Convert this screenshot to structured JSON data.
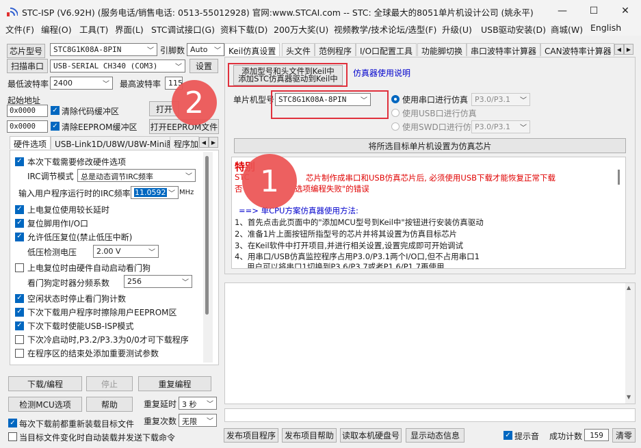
{
  "window": {
    "title": "STC-ISP (V6.92H) (服务电话/销售电话: 0513-55012928) 官网:www.STCAI.com  -- STC: 全球最大的8051单片机设计公司 (姚永平)",
    "minimize": "—",
    "maximize": "☐",
    "close": "✕"
  },
  "menu": [
    "文件(F)",
    "编程(O)",
    "工具(T)",
    "界面(L)",
    "STC调试接口(G)",
    "资料下载(D)",
    "200万大奖(U)",
    "视频教学/技术论坛/选型(F)",
    "升级(U)",
    "USB驱动安装(D)",
    "商城(W)",
    "English"
  ],
  "left": {
    "chip_label": "芯片型号",
    "chip_value": "STC8G1K08A-8PIN",
    "pin_label": "引脚数",
    "pin_value": "Auto",
    "scan_button": "扫描串口",
    "port_value": "USB-SERIAL CH340 (COM3)",
    "settings_button": "设置",
    "min_baud_label": "最低波特率",
    "min_baud_value": "2400",
    "max_baud_label": "最高波特率",
    "max_baud_value": "115",
    "start_addr_label": "起始地址",
    "addr1": "0x0000",
    "clear_code_label": "清除代码缓冲区",
    "open_prog_button": "打开",
    "addr2": "0x0000",
    "clear_eeprom_label": "清除EEPROM缓冲区",
    "open_eeprom_button": "打开EEPROM文件",
    "tabs": [
      "硬件选项",
      "USB-Link1D/U8W/U8W-Mini脱机",
      "程序加"
    ],
    "options": {
      "opt1": "本次下载需要修改硬件选项",
      "irc_mode_label": "IRC调节模式",
      "irc_mode_value": "总是动态调节IRC频率",
      "irc_freq_label": "输入用户程序运行时的IRC频率",
      "irc_freq_value": "11.0592",
      "irc_unit": "MHz",
      "opt2": "上电复位使用较长延时",
      "opt3": "复位脚用作I/O口",
      "opt4": "允许低压复位(禁止低压中断)",
      "lvd_label": "低压检测电压",
      "lvd_value": "2.00 V",
      "opt5": "上电复位时由硬件自动启动看门狗",
      "wdt_label": "看门狗定时器分频系数",
      "wdt_value": "256",
      "opt6": "空闲状态时停止看门狗计数",
      "opt7": "下次下载用户程序时擦除用户EEPROM区",
      "opt8": "下次下载时使能USB-ISP模式",
      "opt9": "下次冷启动时,P3.2/P3.3为0/0才可下载程序",
      "opt10": "在程序区的结束处添加重要测试参数"
    },
    "download_button": "下载/编程",
    "stop_button": "停止",
    "reprogram_button": "重复编程",
    "detect_button": "检测MCU选项",
    "help_button": "帮助",
    "repeat_delay_label": "重复延时",
    "repeat_delay_value": "3 秒",
    "repeat_count_label": "重复次数",
    "repeat_count_value": "无限",
    "reload_label": "每次下载前都重新装载目标文件",
    "auto_load_label": "当目标文件变化时自动装载并发送下载命令"
  },
  "right": {
    "tabs": [
      "Keil仿真设置",
      "头文件",
      "范例程序",
      "I/O口配置工具",
      "功能脚切换",
      "串口波特率计算器",
      "CAN波特率计算器"
    ],
    "add_keil_line1": "添加型号和头文件到Keil中",
    "add_keil_line2": "添加STC仿真器驱动到Keil中",
    "emu_manual_link": "仿真器使用说明",
    "mcu_label": "单片机型号",
    "mcu_value": "STC8G1K08A-8PIN",
    "uart_emu_label": "使用串口进行仿真",
    "uart_emu_value": "P3.0/P3.1",
    "usb_emu_label": "使用USB口进行仿真",
    "swd_emu_label": "使用SWD口进行仿真",
    "swd_emu_value": "P3.0/P3.1",
    "set_emu_button": "将所选目标单片机设置为仿真芯片",
    "notice": {
      "title": "特别",
      "red_line1_start": "STC",
      "red_line1_end": "芯片制作成串口和USB仿真芯片后, 必须使用USB下载才能恢复正常下载",
      "red_line2_start": "否",
      "red_line2_end": "选项编程失败\"的错误",
      "blue_line": "==> 单CPU方案仿真器使用方法:",
      "step1": "1、首先点击此页面中的\"添加MCU型号到Keil中\"按钮进行安装仿真驱动",
      "step2": "2、准备1片上面按钮所指型号的芯片并将其设置为仿真目标芯片",
      "step3": "3、在Keil软件中打开项目,并进行相关设置,设置完成即可开始调试",
      "step4": "4、用串口/USB仿真监控程序占用P3.0/P3.1两个I/O口,但不占用串口1",
      "step5": "用户可以将串口1切换到P3.6/P3.7或者P1.6/P1.7再使用"
    },
    "publish_button": "发布项目程序",
    "publish_help_button": "发布项目帮助",
    "read_disk_button": "读取本机硬盘号",
    "dynamic_info_button": "显示动态信息",
    "beep_label": "提示音",
    "success_label": "成功计数",
    "success_count": "159",
    "clear_button": "清零"
  },
  "annotations": {
    "circle1": "1",
    "circle2": "2"
  },
  "colors": {
    "accent": "#0067c0",
    "annotation_red": "#e0303c",
    "notice_red": "#e00000",
    "notice_blue": "#0000cc"
  }
}
